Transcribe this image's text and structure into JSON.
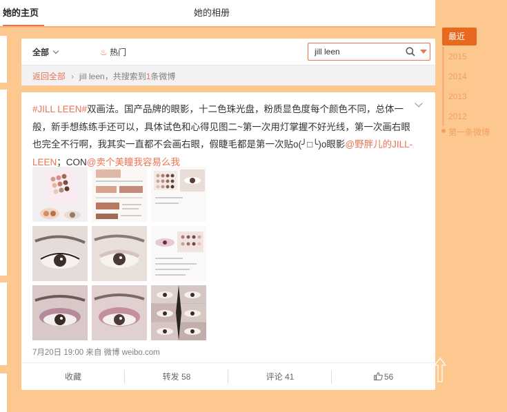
{
  "tabs": [
    {
      "label": "她的主页",
      "active": true
    },
    {
      "label": "她的相册",
      "active": false
    }
  ],
  "filter": {
    "all_label": "全部",
    "hot_label": "热门",
    "search_value": "jill leen",
    "breadcrumb_back": "返回全部",
    "breadcrumb_query": "jill leen，共搜索到",
    "breadcrumb_count": "1",
    "breadcrumb_suffix": "条微博"
  },
  "post": {
    "tag": "#JILL LEEN#",
    "text_1": "双画法。国产品牌的眼影，十二色珠光盘，粉质显色度每个颜色不同，总体一般，新手想练练手还可以，具体试色和心得见图二~第一次用灯掌握不好光线，第一次画右眼也完全不行啊，我其实一直都不会画右眼，假睫毛都是第一次贴o(╯□╰)o眼影",
    "mention_1": "@野胖儿的JILL-LEEN",
    "text_2": "；CON",
    "mention_2": "@卖个美瞳我容易么我",
    "meta": "7月20日 19:00 来自 微博 weibo.com",
    "actions": {
      "collect": "收藏",
      "repost": "转发 58",
      "comment": "评论 41",
      "like": "56"
    }
  },
  "timeline": {
    "current": "最近",
    "years": [
      "2015",
      "2014",
      "2013",
      "2012"
    ],
    "first": "第一条微博"
  },
  "colors": {
    "accent": "#eb7350",
    "background": "#fcc890",
    "timeline_active": "#e8691e"
  }
}
